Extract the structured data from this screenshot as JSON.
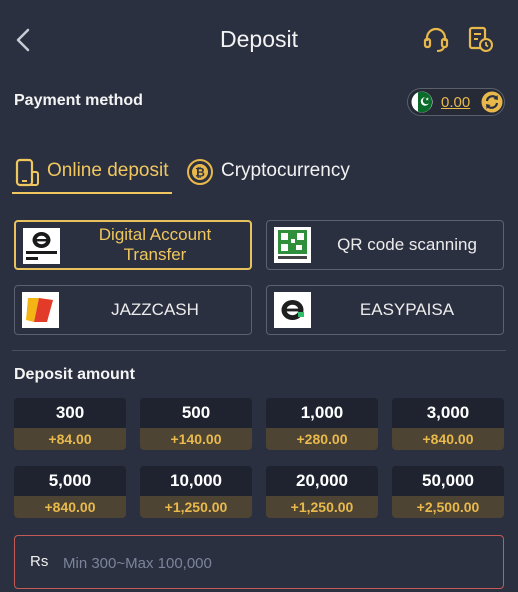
{
  "header": {
    "title": "Deposit"
  },
  "payment_method": {
    "label": "Payment method",
    "balance": "0.00"
  },
  "tabs": [
    {
      "label": "Online deposit",
      "active": true
    },
    {
      "label": "Cryptocurrency",
      "active": false
    }
  ],
  "methods": [
    {
      "label": "Digital Account Transfer",
      "icon": "digital-account-transfer-logo",
      "active": true
    },
    {
      "label": "QR code scanning",
      "icon": "easypaisa-qr-logo",
      "active": false
    },
    {
      "label": "JAZZCASH",
      "icon": "jazzcash-logo",
      "active": false
    },
    {
      "label": "EASYPAISA",
      "icon": "easypaisa-logo",
      "active": false
    }
  ],
  "deposit_amount": {
    "label": "Deposit amount",
    "options": [
      {
        "value": "300",
        "bonus": "+84.00"
      },
      {
        "value": "500",
        "bonus": "+140.00"
      },
      {
        "value": "1,000",
        "bonus": "+280.00"
      },
      {
        "value": "3,000",
        "bonus": "+840.00"
      },
      {
        "value": "5,000",
        "bonus": "+840.00"
      },
      {
        "value": "10,000",
        "bonus": "+1,250.00"
      },
      {
        "value": "20,000",
        "bonus": "+1,250.00"
      },
      {
        "value": "50,000",
        "bonus": "+2,500.00"
      }
    ]
  },
  "input": {
    "currency": "Rs",
    "placeholder": "Min 300~Max 100,000",
    "value": ""
  },
  "colors": {
    "background": "#2b3040",
    "accent": "#f0c75e",
    "bonus": "#e9b94c",
    "input_border": "#c45a55"
  }
}
